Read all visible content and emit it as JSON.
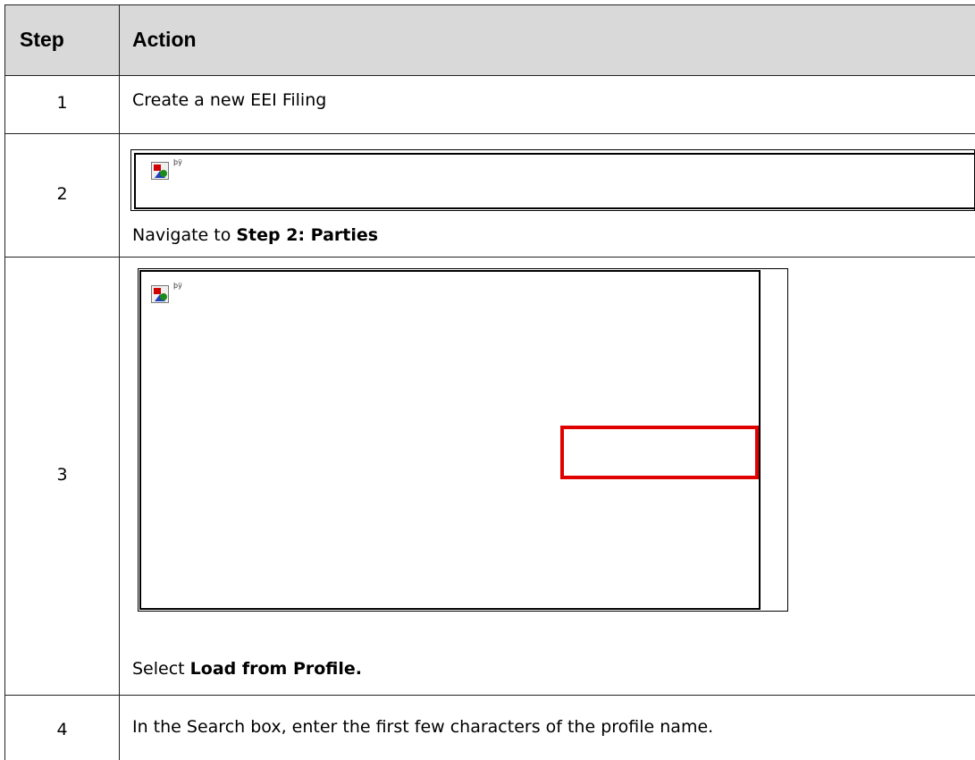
{
  "table": {
    "headers": {
      "step": "Step",
      "action": "Action"
    },
    "rows": [
      {
        "step": "1",
        "action_text": "Create a new EEI Filing"
      },
      {
        "step": "2",
        "image_caption": "þÿ",
        "action_prefix": "Navigate to ",
        "action_bold": "Step 2: Parties"
      },
      {
        "step": "3",
        "image_caption": "þÿ",
        "action_prefix": "Select ",
        "action_bold": "Load from Profile."
      },
      {
        "step": "4",
        "action_text": "In the Search box, enter the first few characters of the profile name."
      }
    ]
  },
  "icons": {
    "broken_image": "broken-image-icon"
  },
  "colors": {
    "header_bg": "#d9d9d9",
    "border": "#222222",
    "highlight": "#e00000"
  }
}
